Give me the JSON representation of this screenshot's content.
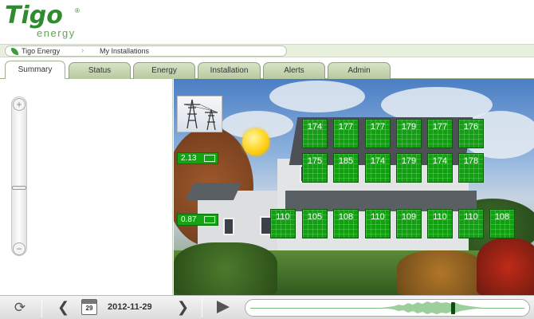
{
  "logo": {
    "brand": "Tigo",
    "sub": "energy",
    "reg": "®"
  },
  "breadcrumb": {
    "items": [
      "Tigo Energy",
      "My Installations"
    ]
  },
  "tabs": [
    "Summary",
    "Status",
    "Energy",
    "Installation",
    "Alerts",
    "Admin"
  ],
  "active_tab": "Summary",
  "zoom": {
    "plus": "+",
    "minus": "−"
  },
  "readouts": {
    "upper": "2.13",
    "lower": "0.87"
  },
  "panels": {
    "row1": [
      "174",
      "177",
      "177",
      "179",
      "177",
      "176"
    ],
    "row2": [
      "175",
      "185",
      "174",
      "179",
      "174",
      "178"
    ],
    "row3": [
      "110",
      "105",
      "108",
      "110",
      "109",
      "110",
      "110",
      "108"
    ]
  },
  "toolbar": {
    "calendar_day": "29",
    "date": "2012-11-29",
    "prev": "❮",
    "next": "❯",
    "refresh": "⟳"
  },
  "colors": {
    "accent": "#2e8b2e",
    "panel": "#12a012",
    "readout": "#13a313"
  },
  "icons": [
    "leaf-icon",
    "refresh-icon",
    "calendar-icon",
    "play-icon",
    "transmission-tower-icon",
    "sun-icon",
    "meter-icon"
  ]
}
